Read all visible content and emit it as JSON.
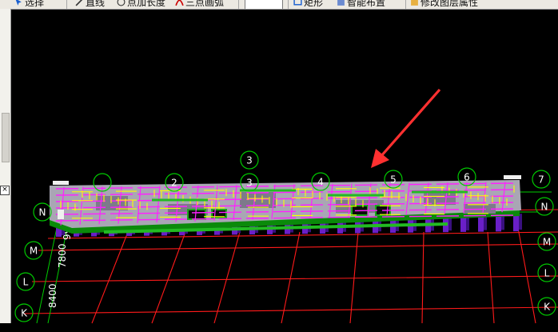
{
  "toolbar": {
    "items": [
      {
        "label": "选择",
        "icon": "select-arrow-icon"
      },
      {
        "label": "直线",
        "icon": "line-icon"
      },
      {
        "label": "点加长度",
        "icon": "point-length-icon"
      },
      {
        "label": "三点画弧",
        "icon": "three-point-arc-icon"
      },
      {
        "label": "矩形",
        "icon": "rectangle-icon"
      },
      {
        "label": "智能布置",
        "icon": "smart-layout-icon"
      },
      {
        "label": "修改图层属性",
        "icon": "modify-layer-icon"
      }
    ]
  },
  "cad_view": {
    "top_axis_labels": [
      "2",
      "3",
      "3",
      "4",
      "5",
      "6",
      "7"
    ],
    "left_axis_labels": [
      "N",
      "M",
      "L",
      "K"
    ],
    "right_axis_labels": [
      "N",
      "M",
      "L",
      "K"
    ],
    "dimension_labels": [
      "99",
      "7800",
      "8400"
    ],
    "colors": {
      "background": "#000000",
      "axis_bubble": "#00c800",
      "grid_line": "#ff1a1a",
      "dimension_line": "#00cc00",
      "slab": "#a9a6b4",
      "beam_magenta": "#ff20ff",
      "rebar_yellow": "#ffff00",
      "column_purple": "#6a1fc8",
      "annotation_arrow": "#ff3030"
    }
  },
  "panel": {
    "close_glyph": "×"
  }
}
